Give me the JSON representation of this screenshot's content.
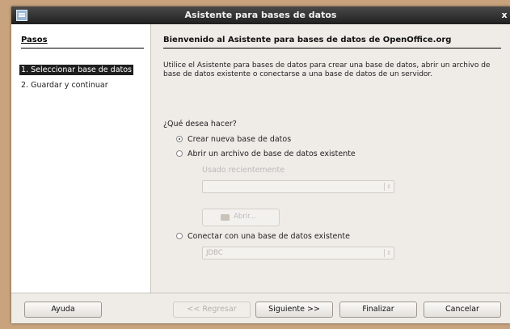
{
  "window": {
    "title": "Asistente para bases de datos",
    "close_glyph": "x"
  },
  "steps": {
    "header": "Pasos",
    "items": [
      {
        "label": "1. Seleccionar base de datos"
      },
      {
        "label": "2. Guardar y continuar"
      }
    ]
  },
  "main": {
    "heading": "Bienvenido al Asistente para bases de datos de OpenOffice.org",
    "intro": "Utilice el Asistente para bases de datos para crear una base de datos, abrir un archivo de base de datos existente o conectarse a una base de datos de un servidor.",
    "question": "¿Qué desea hacer?",
    "options": {
      "create": "Crear nueva base de datos",
      "open": "Abrir un archivo de base de datos existente",
      "recent_label": "Usado recientemente",
      "open_button": "Abrir...",
      "connect": "Conectar con una base de datos existente",
      "connect_type": "JDBC"
    }
  },
  "buttons": {
    "help": "Ayuda",
    "back": "<< Regresar",
    "next": "Siguiente >>",
    "finish": "Finalizar",
    "cancel": "Cancelar"
  }
}
